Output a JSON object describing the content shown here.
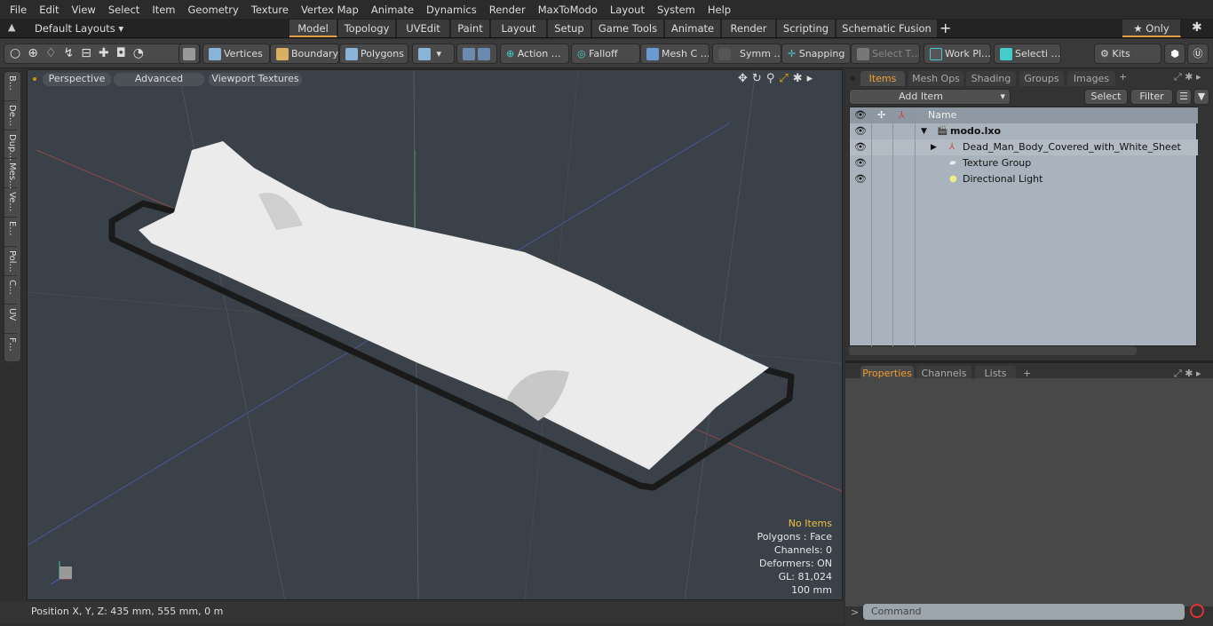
{
  "menu": [
    "File",
    "Edit",
    "View",
    "Select",
    "Item",
    "Geometry",
    "Texture",
    "Vertex Map",
    "Animate",
    "Dynamics",
    "Render",
    "MaxToModo",
    "Layout",
    "System",
    "Help"
  ],
  "layouts": {
    "selector": "Default Layouts ▾",
    "tabs": [
      "Model",
      "Topology",
      "UVEdit",
      "Paint",
      "Layout",
      "Setup",
      "Game Tools",
      "Animate",
      "Render",
      "Scripting",
      "Schematic Fusion"
    ],
    "active": "Model",
    "add": "+",
    "only": "★ Only"
  },
  "toolbar": {
    "vertices": "Vertices",
    "boundary": "Boundary",
    "polygons": "Polygons",
    "action": "Action …",
    "falloff": "Falloff",
    "mesh": "Mesh C …",
    "symm": "Symm …",
    "snapping": "Snapping",
    "select_t": "Select T…",
    "work": "Work Pl…",
    "selecti": "Selecti …",
    "kits": "Kits"
  },
  "left_tabs": [
    "B…",
    "De…",
    "Dup…",
    "Mes…",
    "Ve…",
    "E…",
    "Pol…",
    "C…",
    "UV",
    "F…"
  ],
  "viewport": {
    "perspective": "Perspective",
    "advanced": "Advanced",
    "textures": "Viewport Textures",
    "info": {
      "no_items": "No Items",
      "polygons": "Polygons : Face",
      "channels": "Channels: 0",
      "deformers": "Deformers: ON",
      "gl": "GL: 81,024",
      "scale": "100 mm"
    }
  },
  "status": {
    "position": "Position X, Y, Z:   435 mm, 555 mm, 0 m"
  },
  "items_panel": {
    "tabs": [
      "Items",
      "Mesh Ops",
      "Shading",
      "Groups",
      "Images"
    ],
    "active": "Items",
    "add_item": "Add Item",
    "select": "Select",
    "filter": "Filter",
    "name_col": "Name",
    "rows": [
      {
        "name": "modo.lxo",
        "bold": true
      },
      {
        "name": "Dead_Man_Body_Covered_with_White_Sheet"
      },
      {
        "name": "Texture Group"
      },
      {
        "name": "Directional Light"
      }
    ]
  },
  "props_panel": {
    "tabs": [
      "Properties",
      "Channels",
      "Lists"
    ],
    "active": "Properties"
  },
  "command": {
    "placeholder": "Command"
  },
  "colors": {
    "accent": "#f0a030",
    "viewport_bg": "#3a4148",
    "list_bg": "#a9b3bd"
  }
}
